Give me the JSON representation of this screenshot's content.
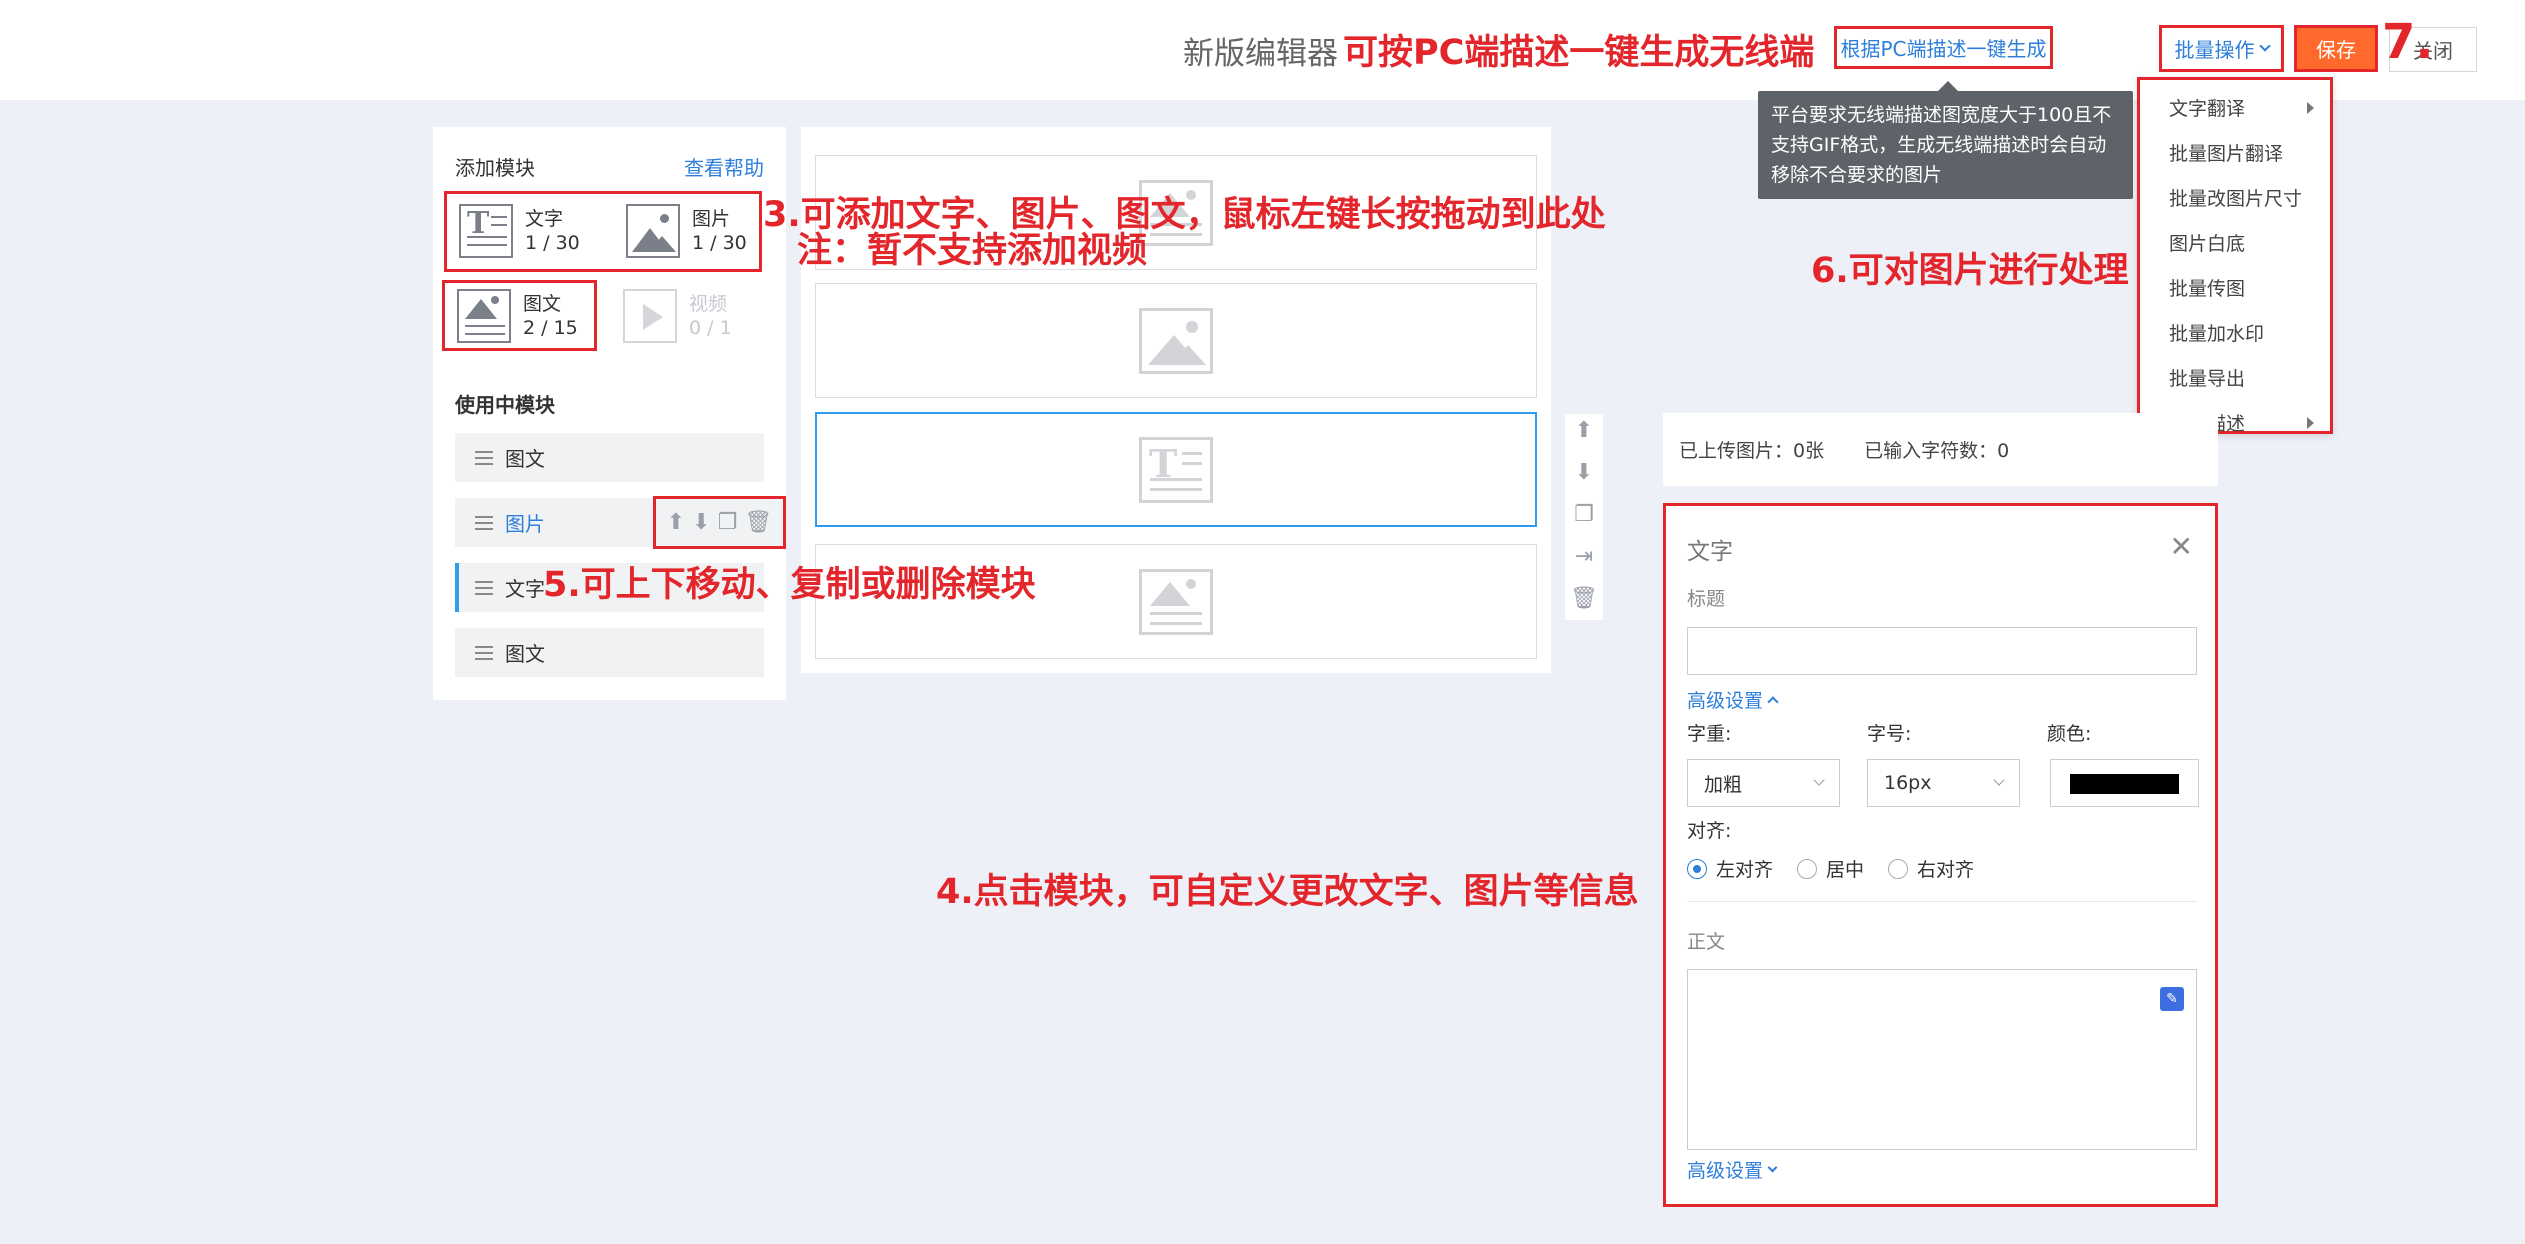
{
  "topbar": {
    "title": "新版编辑器",
    "annotation_generate": "可按PC端描述一键生成无线端",
    "generate_button": "根据PC端描述一键生成",
    "batch_button": "批量操作",
    "save_button": "保存",
    "close_button": "关闭",
    "annotation_7": "7."
  },
  "tooltip": {
    "text": "平台要求无线端描述图宽度大于100且不支持GIF格式，生成无线端描述时会自动移除不合要求的图片"
  },
  "batch_menu": {
    "items": [
      {
        "label": "文字翻译",
        "has_submenu": true
      },
      {
        "label": "批量图片翻译",
        "has_submenu": false
      },
      {
        "label": "批量改图片尺寸",
        "has_submenu": false
      },
      {
        "label": "图片白底",
        "has_submenu": false
      },
      {
        "label": "批量传图",
        "has_submenu": false
      },
      {
        "label": "批量加水印",
        "has_submenu": false
      },
      {
        "label": "批量导出",
        "has_submenu": false
      },
      {
        "label": "清空描述",
        "has_submenu": true
      }
    ]
  },
  "left_panel": {
    "add_title": "添加模块",
    "help_link": "查看帮助",
    "modules": [
      {
        "name": "文字",
        "count": "1 / 30",
        "icon": "text-module-icon",
        "disabled": false
      },
      {
        "name": "图片",
        "count": "1 / 30",
        "icon": "image-module-icon",
        "disabled": false
      },
      {
        "name": "图文",
        "count": "2 / 15",
        "icon": "image-text-module-icon",
        "disabled": false
      },
      {
        "name": "视频",
        "count": "0 / 1",
        "icon": "video-module-icon",
        "disabled": true
      }
    ],
    "using_title": "使用中模块",
    "using_modules": [
      {
        "label": "图文"
      },
      {
        "label": "图片"
      },
      {
        "label": "文字"
      },
      {
        "label": "图文"
      }
    ]
  },
  "stats": {
    "uploaded_images": "已上传图片：0张",
    "char_count": "已输入字符数：0"
  },
  "settings": {
    "title": "文字",
    "title_label": "标题",
    "title_value": "",
    "advanced_label": "高级设置",
    "weight_label": "字重:",
    "weight_value": "加粗",
    "size_label": "字号:",
    "size_value": "16px",
    "color_label": "颜色:",
    "color_value": "#000000",
    "align_label": "对齐:",
    "align_options": [
      "左对齐",
      "居中",
      "右对齐"
    ],
    "align_selected": "左对齐",
    "body_label": "正文",
    "body_value": "",
    "advanced_label_bottom": "高级设置"
  },
  "annotations": {
    "a3_line1": "3.可添加文字、图片、图文，鼠标左键长按拖动到此处",
    "a3_line2": "注：暂不支持添加视频",
    "a4": "4.点击模块，可自定义更改文字、图片等信息",
    "a5": "5.可上下移动、复制或删除模块",
    "a6": "6.可对图片进行处理"
  },
  "colors": {
    "accent": "#2e7fd9",
    "save": "#ff6a2c",
    "annotation": "#e3262b",
    "selected_border": "#2e9dee"
  }
}
